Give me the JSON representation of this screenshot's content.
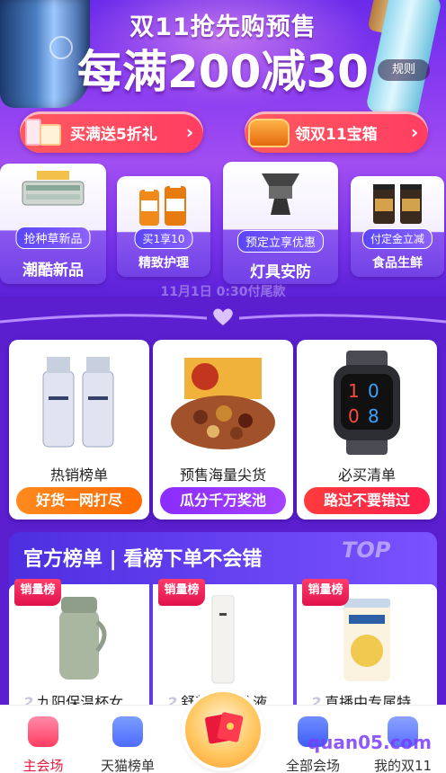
{
  "banner": {
    "title": "双11抢先购预售",
    "headline": "每满200减30",
    "rules_label": "规则"
  },
  "promo_pills": [
    {
      "label": "买满送5折礼"
    },
    {
      "label": "领双11宝箱"
    }
  ],
  "categories": [
    {
      "badge": "抢种草新品",
      "label": "潮酷新品"
    },
    {
      "badge": "买1享10",
      "label": "精致护理"
    },
    {
      "badge": "预定立享优惠",
      "label": "灯具安防"
    },
    {
      "badge": "付定金立减",
      "label": "食品生鲜"
    }
  ],
  "ghost_text": "11月1日 0:30付尾款",
  "cards": [
    {
      "name": "热销榜单",
      "tag": "好货一网打尽",
      "color": "#ff7a12"
    },
    {
      "name": "预售海量尖货",
      "tag": "瓜分千万奖池",
      "color": "#9533ff"
    },
    {
      "name": "必买清单",
      "tag": "路过不要错过",
      "color": "#ff2c44"
    }
  ],
  "ranking": {
    "title": "官方榜单 | 看榜下单不会错",
    "top_label": "TOP",
    "items": [
      {
        "badge": "销量榜",
        "rank": "2",
        "name": "九阳保温杯女"
      },
      {
        "badge": "销量榜",
        "rank": "2",
        "name": "舒颜修护乳液"
      },
      {
        "badge": "销量榜",
        "rank": "2",
        "name": "直播中专属特"
      }
    ]
  },
  "tabbar": {
    "items": [
      {
        "label": "主会场",
        "active": true,
        "icon": "home-icon"
      },
      {
        "label": "天猫榜单",
        "active": false,
        "icon": "list-icon"
      },
      {
        "label": "全部会场",
        "active": false,
        "icon": "grid-icon"
      },
      {
        "label": "我的双11",
        "active": false,
        "icon": "user-icon"
      }
    ],
    "center_icon": "red-envelope-icon"
  },
  "watermark": "quan05.com"
}
